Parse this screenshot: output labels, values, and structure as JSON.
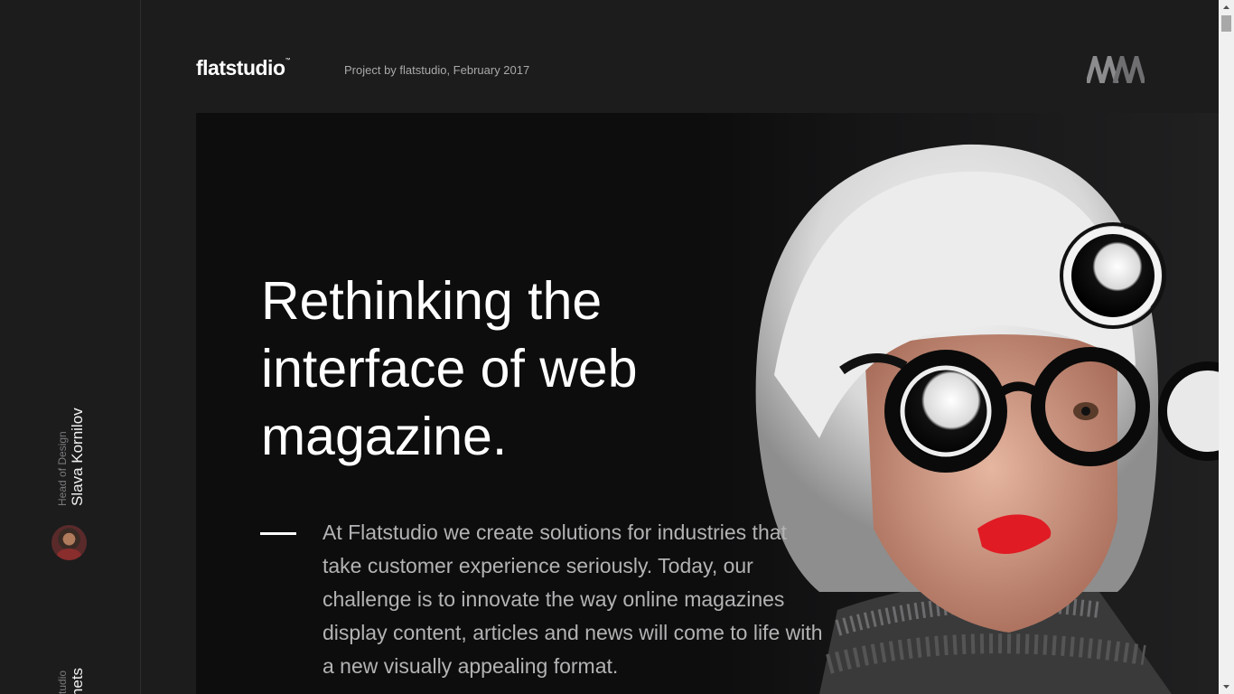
{
  "header": {
    "logo": "flatstudio",
    "logo_tm": "™",
    "project": "Project by flatstudio, February 2017",
    "brand_mark": "mm-logo-icon"
  },
  "sidebar": {
    "credits": [
      {
        "role": "Head of Design",
        "name": "Slava Kornilov"
      },
      {
        "role": "flatstudio",
        "name": "nonets"
      }
    ]
  },
  "hero": {
    "headline": "Rethinking the interface of web magazine.",
    "intro": "At Flatstudio we create solutions for industries that take customer experience seriously. Today, our challenge is to innovate the way online magazines display content, articles and news will come to life with a new visually appealing format."
  },
  "colors": {
    "background": "#1c1c1d",
    "hero_bg": "#0d0d0e",
    "text": "#ffffff",
    "muted_text": "#b3b3b5",
    "lip_red": "#e01b24"
  }
}
